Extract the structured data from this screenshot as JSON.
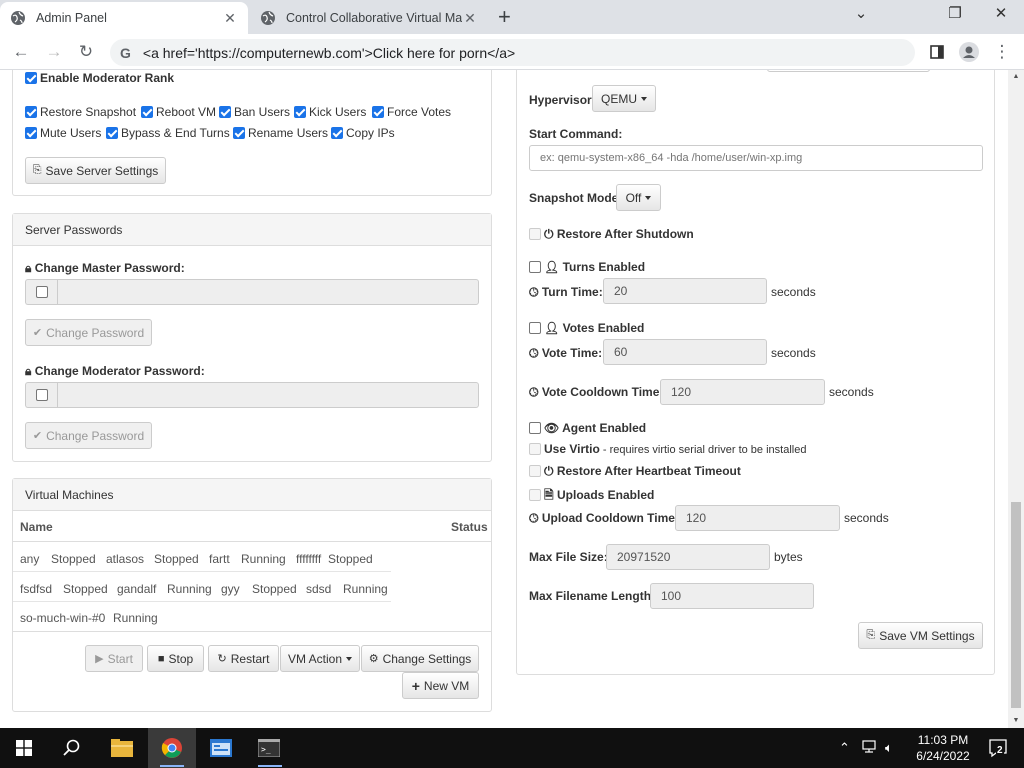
{
  "browser": {
    "tabs": [
      {
        "title": "Admin Panel",
        "active": true
      },
      {
        "title": "Control Collaborative Virtual Mac",
        "active": false
      }
    ],
    "address": "<a href='https://computernewb.com'>Click here for porn</a>"
  },
  "permissions": {
    "moderator_rank": "Enable Moderator Rank",
    "items": [
      {
        "label": "Restore Snapshot"
      },
      {
        "label": "Reboot VM"
      },
      {
        "label": "Ban Users"
      },
      {
        "label": "Kick Users"
      },
      {
        "label": "Force Votes"
      },
      {
        "label": "Mute Users"
      },
      {
        "label": "Bypass & End Turns"
      },
      {
        "label": "Rename Users"
      },
      {
        "label": "Copy IPs"
      }
    ],
    "save_label": "Save Server Settings"
  },
  "passwords": {
    "heading": "Server Passwords",
    "master_label": "Change Master Password:",
    "moderator_label": "Change Moderator Password:",
    "change_label": "Change Password"
  },
  "vms": {
    "heading": "Virtual Machines",
    "col_name": "Name",
    "col_status": "Status",
    "rows": [
      [
        {
          "name": "any",
          "status": "Stopped"
        },
        {
          "name": "atlasos",
          "status": "Stopped"
        },
        {
          "name": "fartt",
          "status": "Running"
        },
        {
          "name": "ffffffff",
          "status": "Stopped"
        }
      ],
      [
        {
          "name": "fsdfsd",
          "status": "Stopped"
        },
        {
          "name": "gandalf",
          "status": "Running"
        },
        {
          "name": "gyy",
          "status": "Stopped"
        },
        {
          "name": "sdsd",
          "status": "Running"
        }
      ],
      [
        {
          "name": "so-much-win-#0",
          "status": "Running"
        }
      ]
    ],
    "buttons": {
      "start": "Start",
      "stop": "Stop",
      "restart": "Restart",
      "action": "VM Action",
      "settings": "Change Settings",
      "new_vm": "New VM"
    }
  },
  "vm_settings": {
    "hypervisor_label": "Hypervisor:",
    "hypervisor_value": "QEMU",
    "start_command_label": "Start Command:",
    "start_command_placeholder": "ex: qemu-system-x86_64 -hda /home/user/win-xp.img",
    "snapshot_label": "Snapshot Mode:",
    "snapshot_value": "Off",
    "restore_shutdown": "Restore After Shutdown",
    "turns_enabled": "Turns Enabled",
    "turn_time_label": "Turn Time:",
    "turn_time_value": "20",
    "votes_enabled": "Votes Enabled",
    "vote_time_label": "Vote Time:",
    "vote_time_value": "60",
    "vote_cooldown_label": "Vote Cooldown Time:",
    "vote_cooldown_value": "120",
    "seconds": "seconds",
    "agent_enabled": "Agent Enabled",
    "use_virtio": "Use Virtio",
    "virtio_note": "- requires virtio serial driver to be installed",
    "restore_heartbeat": "Restore After Heartbeat Timeout",
    "uploads_enabled": "Uploads Enabled",
    "upload_cooldown_label": "Upload Cooldown Time:",
    "upload_cooldown_value": "120",
    "max_file_size_label": "Max File Size:",
    "max_file_size_value": "20971520",
    "bytes": "bytes",
    "max_filename_label": "Max Filename Length:",
    "max_filename_value": "100",
    "save_label": "Save VM Settings"
  },
  "taskbar": {
    "time": "11:03 PM",
    "date": "6/24/2022",
    "notifications": "2"
  }
}
